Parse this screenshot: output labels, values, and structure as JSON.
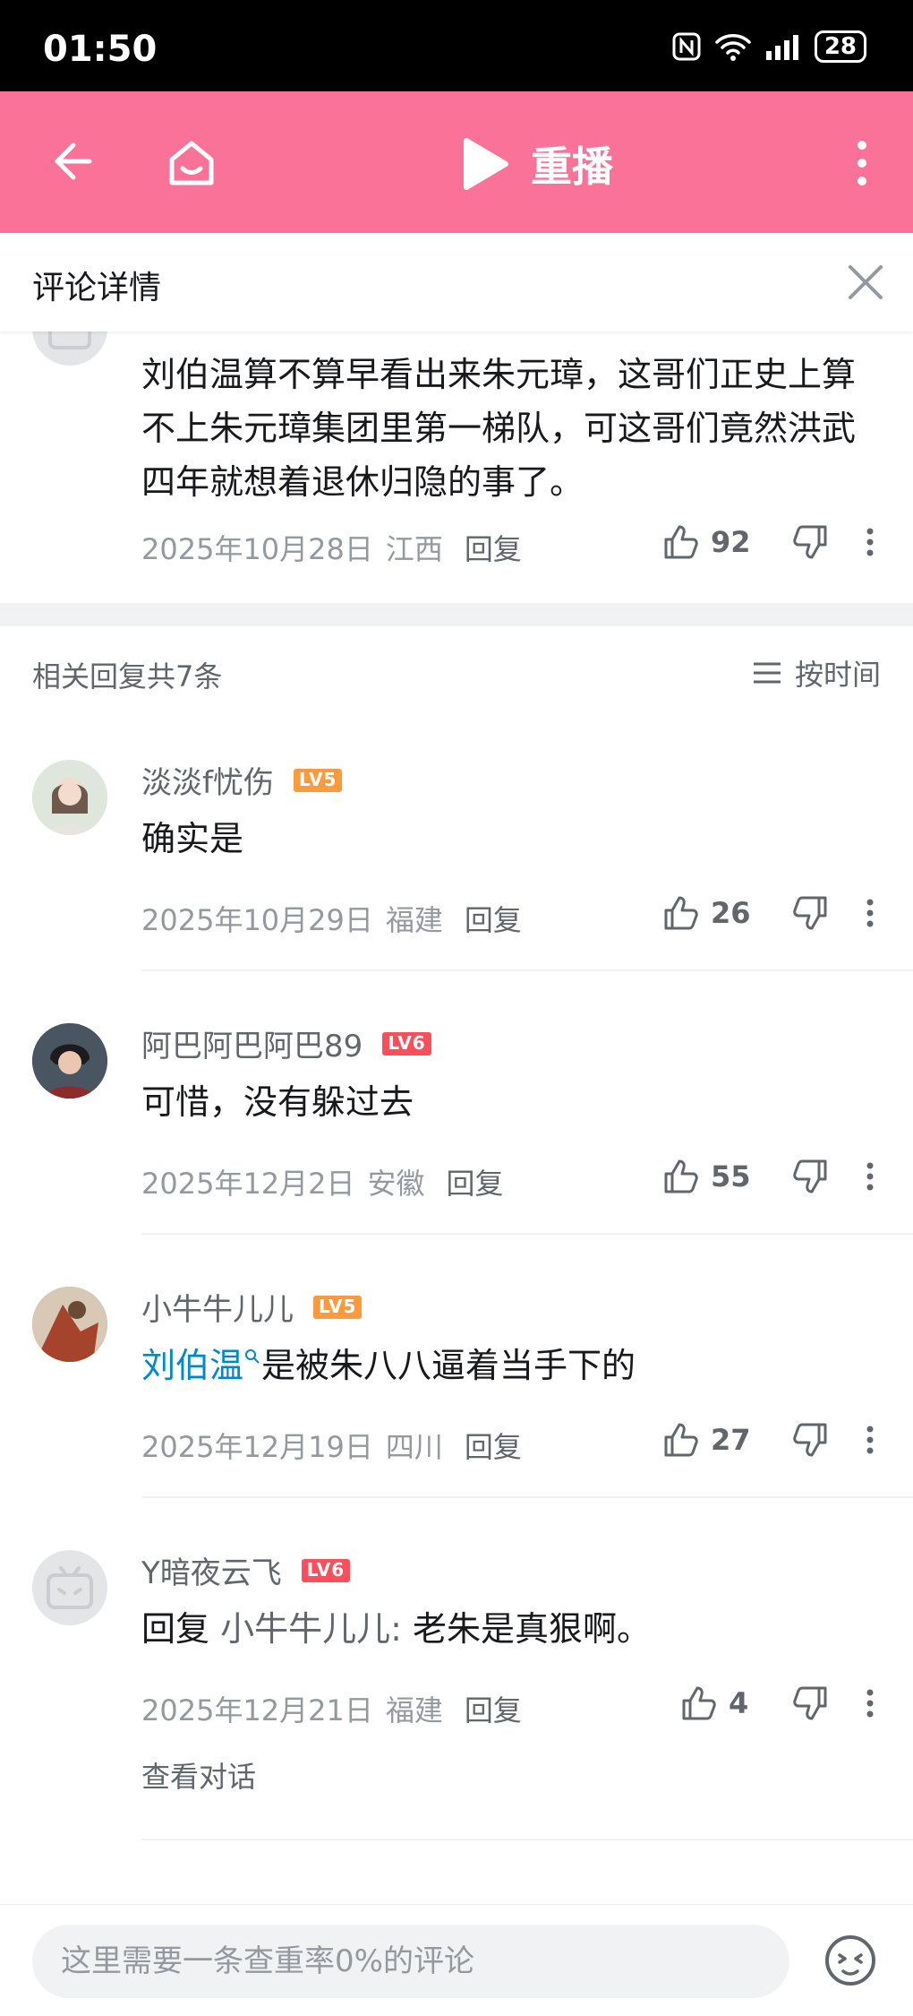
{
  "status_bar": {
    "time": "01:50",
    "battery": "28"
  },
  "topbar": {
    "replay_label": "重播"
  },
  "subheader": {
    "title": "评论详情"
  },
  "main_comment": {
    "text": "刘伯温算不算早看出来朱元璋，这哥们正史上算不上朱元璋集团里第一梯队，可这哥们竟然洪武四年就想着退休归隐的事了。",
    "date": "2025年10月28日",
    "location": "江西",
    "reply_label": "回复",
    "likes": "92"
  },
  "replies_header": {
    "count_label": "相关回复共7条",
    "sort_label": "按时间"
  },
  "replies": [
    {
      "name": "淡淡f忧伤",
      "level": "LV5",
      "text": "确实是",
      "date": "2025年10月29日",
      "location": "福建",
      "reply_label": "回复",
      "likes": "26"
    },
    {
      "name": "阿巴阿巴阿巴89",
      "level": "LV6",
      "text": "可惜，没有躲过去",
      "date": "2025年12月2日",
      "location": "安徽",
      "reply_label": "回复",
      "likes": "55"
    },
    {
      "name": "小牛牛儿儿",
      "level": "LV5",
      "link_text": "刘伯温",
      "text": "是被朱八八逼着当手下的",
      "date": "2025年12月19日",
      "location": "四川",
      "reply_label": "回复",
      "likes": "27"
    },
    {
      "name": "Y暗夜云飞",
      "level": "LV6",
      "reply_prefix": "回复",
      "mention": "小牛牛儿儿:",
      "text": "老朱是真狠啊。",
      "date": "2025年12月21日",
      "location": "福建",
      "reply_label": "回复",
      "likes": "4",
      "view_conversation": "查看对话"
    }
  ],
  "bottom_bar": {
    "placeholder": "这里需要一条查重率0%的评论"
  },
  "colors": {
    "brand_pink": "#fb7299",
    "link_blue": "#008ac5",
    "level5": "#ff9a3c",
    "level6": "#ff4d5c"
  }
}
